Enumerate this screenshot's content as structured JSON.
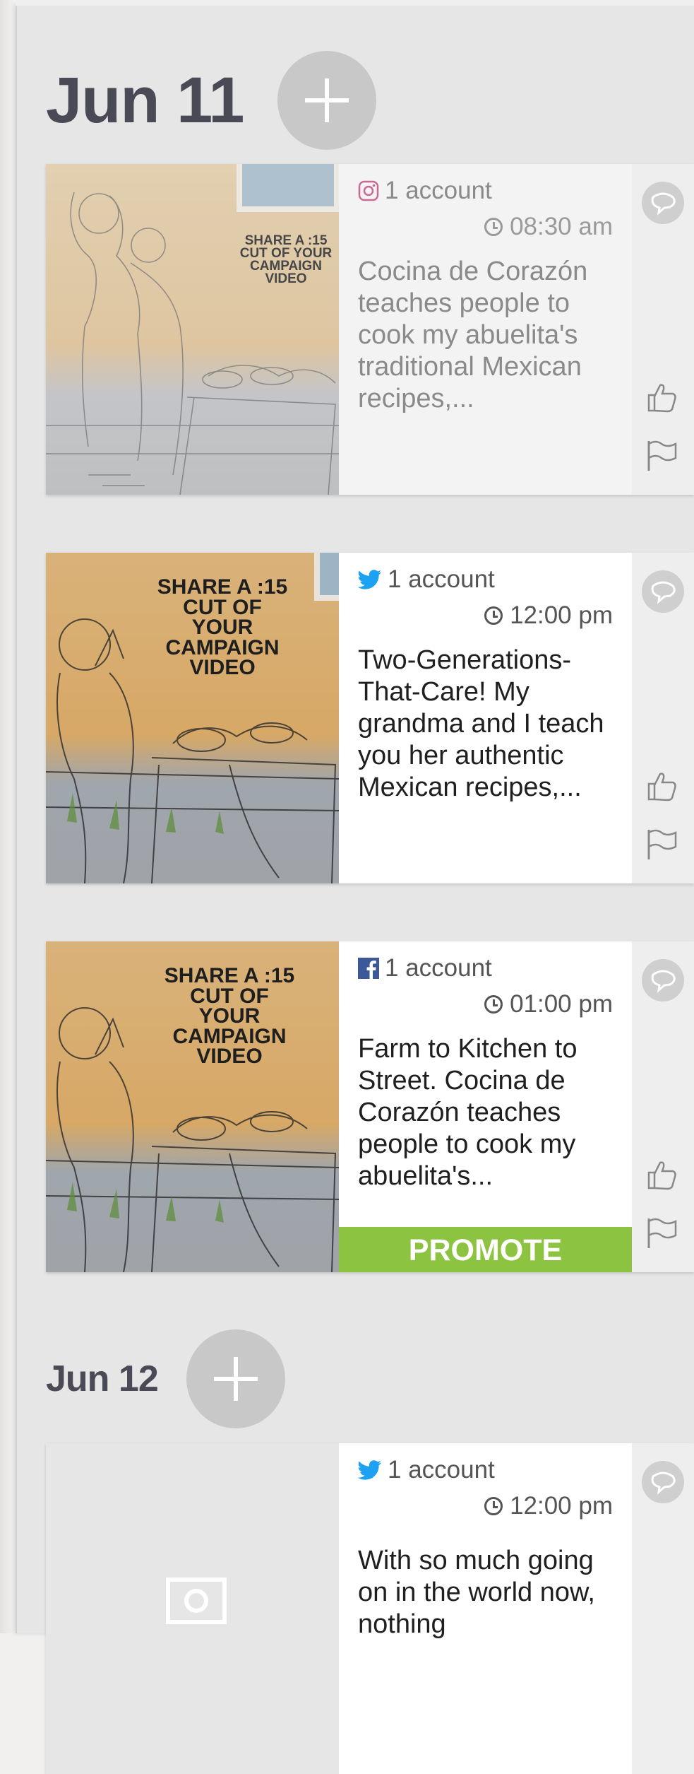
{
  "days": [
    {
      "date": "Jun 11",
      "posts": [
        {
          "network": "instagram",
          "account_label": "1 account",
          "time": "08:30 am",
          "text": "Cocina de Corazón teaches people to cook my abuelita's traditional Mexican recipes,...",
          "image_caption": "SHARE A :15 CUT OF YOUR CAMPAIGN VIDEO",
          "state": "past"
        },
        {
          "network": "twitter",
          "account_label": "1 account",
          "time": "12:00 pm",
          "text": "Two-Generations-That-Care! My grandma and I teach you her authentic Mexican recipes,...",
          "image_caption": "SHARE A :15 CUT OF YOUR CAMPAIGN VIDEO",
          "state": "scheduled"
        },
        {
          "network": "facebook",
          "account_label": "1 account",
          "time": "01:00 pm",
          "text": "Farm to Kitchen to Street. Cocina de Corazón teaches people to cook my abuelita's...",
          "image_caption": "SHARE A :15 CUT OF YOUR CAMPAIGN VIDEO",
          "promote_label": "PROMOTE",
          "state": "scheduled"
        }
      ]
    },
    {
      "date": "Jun 12",
      "posts": [
        {
          "network": "twitter",
          "account_label": "1 account",
          "time": "12:00 pm",
          "text": "With so much going on in the world now, nothing",
          "image_caption": "",
          "state": "scheduled"
        }
      ]
    }
  ],
  "icons": {
    "add": "plus-icon",
    "comment": "speech-bubble-icon",
    "like": "thumbs-up-icon",
    "flag": "flag-icon",
    "time": "clock-icon",
    "image_placeholder": "image-icon",
    "instagram": "instagram-icon",
    "twitter": "twitter-icon",
    "facebook": "facebook-icon"
  },
  "colors": {
    "promote": "#8cc341",
    "twitter": "#1da1f2",
    "facebook": "#3b5998",
    "instagram": "#c13584",
    "add_button": "#c8c8c8"
  }
}
